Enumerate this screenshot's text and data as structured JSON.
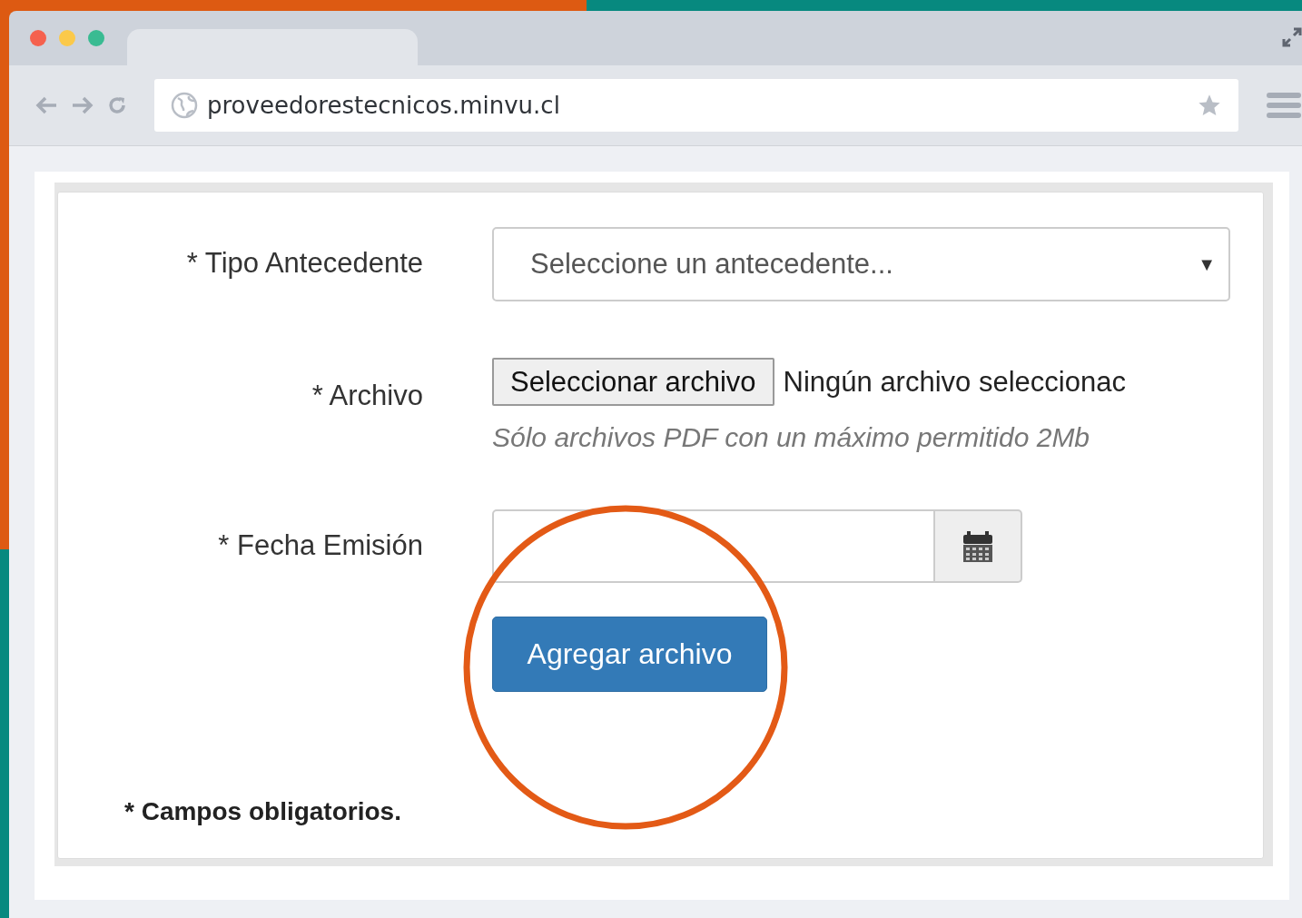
{
  "browser": {
    "url": "proveedorestecnicos.minvu.cl"
  },
  "form": {
    "fields": [
      {
        "kind": "select",
        "label": "* Tipo Antecedente",
        "placeholder": "Seleccione un antecedente...",
        "caret": "▼"
      },
      {
        "kind": "file",
        "label": "* Archivo",
        "button": "Seleccionar archivo",
        "status": "Ningún archivo seleccionac",
        "hint": "Sólo archivos PDF con un máximo permitido 2Mb"
      },
      {
        "kind": "date",
        "label": "* Fecha Emisión"
      }
    ],
    "submit": "Agregar archivo",
    "footnote": "* Campos obligatorios."
  },
  "highlight": {
    "kind": "circle",
    "color": "#e35a16"
  }
}
